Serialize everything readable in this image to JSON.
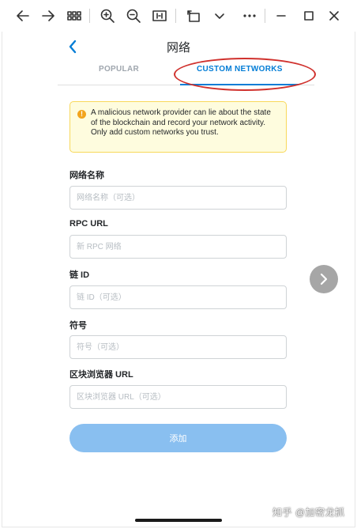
{
  "toolbar": {
    "items": [
      {
        "name": "back-arrow-icon"
      },
      {
        "name": "forward-arrow-icon"
      },
      {
        "name": "grid-view-icon"
      },
      {
        "name": "zoom-in-icon"
      },
      {
        "name": "zoom-out-icon"
      },
      {
        "name": "fit-page-icon"
      },
      {
        "name": "rotate-icon"
      },
      {
        "name": "chevron-down-icon"
      },
      {
        "name": "more-icon"
      },
      {
        "name": "minimize-icon"
      },
      {
        "name": "maximize-icon"
      },
      {
        "name": "close-icon"
      }
    ]
  },
  "header": {
    "title": "网络"
  },
  "tabs": {
    "popular": "POPULAR",
    "custom": "CUSTOM NETWORKS",
    "active": "custom"
  },
  "warning": {
    "icon": "!",
    "text": "A malicious network provider can lie about the state of the blockchain and record your network activity. Only add custom networks you trust."
  },
  "form": {
    "network_name": {
      "label": "网络名称",
      "placeholder": "网络名称（可选）"
    },
    "rpc_url": {
      "label": "RPC URL",
      "placeholder": "新 RPC 网络"
    },
    "chain_id": {
      "label": "链 ID",
      "placeholder": "链 ID（可选）"
    },
    "symbol": {
      "label": "符号",
      "placeholder": "符号（可选）"
    },
    "explorer_url": {
      "label": "区块浏览器 URL",
      "placeholder": "区块浏览器 URL（可选）"
    },
    "submit_label": "添加"
  },
  "watermark": "知乎 @加密龙抓",
  "colors": {
    "accent": "#037dd6",
    "button_disabled": "#89bff0",
    "warning_bg": "#fefcde",
    "warning_border": "#f8d85a",
    "annotation": "#d0312d"
  }
}
